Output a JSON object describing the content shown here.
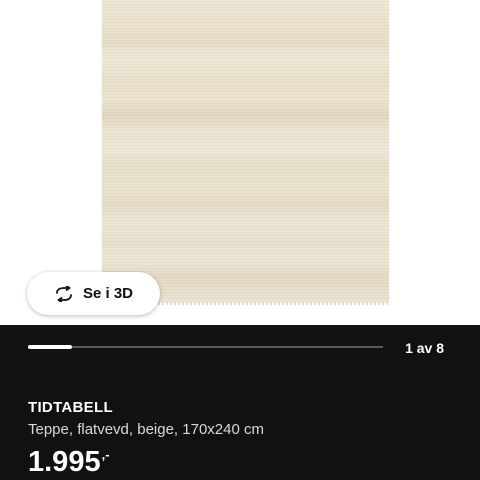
{
  "gallery": {
    "view_3d_label": "Se i 3D",
    "view_3d_icon": "rotate-3d-icon",
    "pager_text": "1 av 8",
    "current_image": 1,
    "total_images": 8,
    "progress": 0.125
  },
  "product": {
    "name": "TIDTABELL",
    "description": "Teppe, flatvevd, beige, 170x240 cm",
    "price": "1.995",
    "price_suffix": ",-"
  },
  "colors": {
    "info_background": "#111111",
    "text": "#ffffff",
    "secondary_text": "#d9d9d9",
    "track": "#5a5a5a",
    "track_fill": "#ffffff"
  }
}
